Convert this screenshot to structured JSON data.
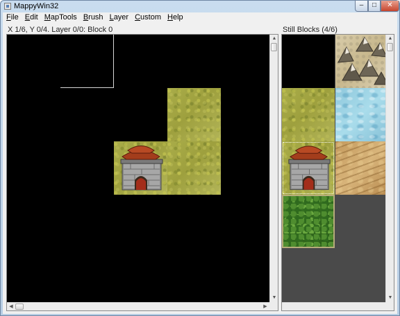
{
  "window": {
    "title": "MappyWin32",
    "minimize_glyph": "–",
    "maximize_glyph": "□",
    "close_glyph": "✕"
  },
  "menu": [
    {
      "mnemonic": "F",
      "rest": "ile"
    },
    {
      "mnemonic": "E",
      "rest": "dit"
    },
    {
      "mnemonic": "M",
      "rest": "apTools"
    },
    {
      "mnemonic": "B",
      "rest": "rush"
    },
    {
      "mnemonic": "L",
      "rest": "ayer"
    },
    {
      "mnemonic": "C",
      "rest": "ustom"
    },
    {
      "mnemonic": "H",
      "rest": "elp"
    }
  ],
  "map_panel": {
    "status": "X 1/6, Y 0/4. Layer 0/0: Block 0",
    "tiles": [
      {
        "type": "grass",
        "label": "grass-tile"
      },
      {
        "type": "grass",
        "label": "grass-tile"
      },
      {
        "type": "castle",
        "label": "castle-tile"
      }
    ]
  },
  "blocks_panel": {
    "label": "Still Blocks (4/6)",
    "blocks": [
      {
        "type": "empty"
      },
      {
        "type": "mountain"
      },
      {
        "type": "grass"
      },
      {
        "type": "water"
      },
      {
        "type": "castle",
        "selected": true
      },
      {
        "type": "sand"
      },
      {
        "type": "forest"
      }
    ]
  },
  "scroll_arrows": {
    "up": "▲",
    "down": "▼",
    "left": "◀",
    "right": "▶"
  }
}
